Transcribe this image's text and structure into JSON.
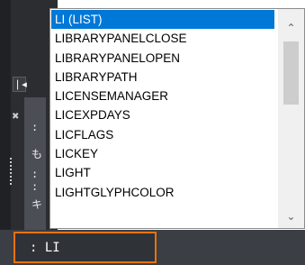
{
  "window": {
    "title": ""
  },
  "left_panel": {
    "nav_icon": "collapse-left-icon",
    "close_icon": "close-icon",
    "palette_marks": [
      ":",
      "も",
      ":",
      ":",
      "キ"
    ]
  },
  "autocomplete": {
    "items": [
      "LI (LIST)",
      "LIBRARYPANELCLOSE",
      "LIBRARYPANELOPEN",
      "LIBRARYPATH",
      "LICENSEMANAGER",
      "LICEXPDAYS",
      "LICFLAGS",
      "LICKEY",
      "LIGHT",
      "LIGHTGLYPHCOLOR"
    ],
    "selected_index": 0,
    "scroll_up_icon": "chevron-up-icon",
    "scroll_down_icon": "chevron-down-icon"
  },
  "command_line": {
    "prompt": ":",
    "value": "LI"
  },
  "colors": {
    "selection": "#0078d7",
    "highlight_border": "#e8720c",
    "workspace": "#2b2d31"
  }
}
